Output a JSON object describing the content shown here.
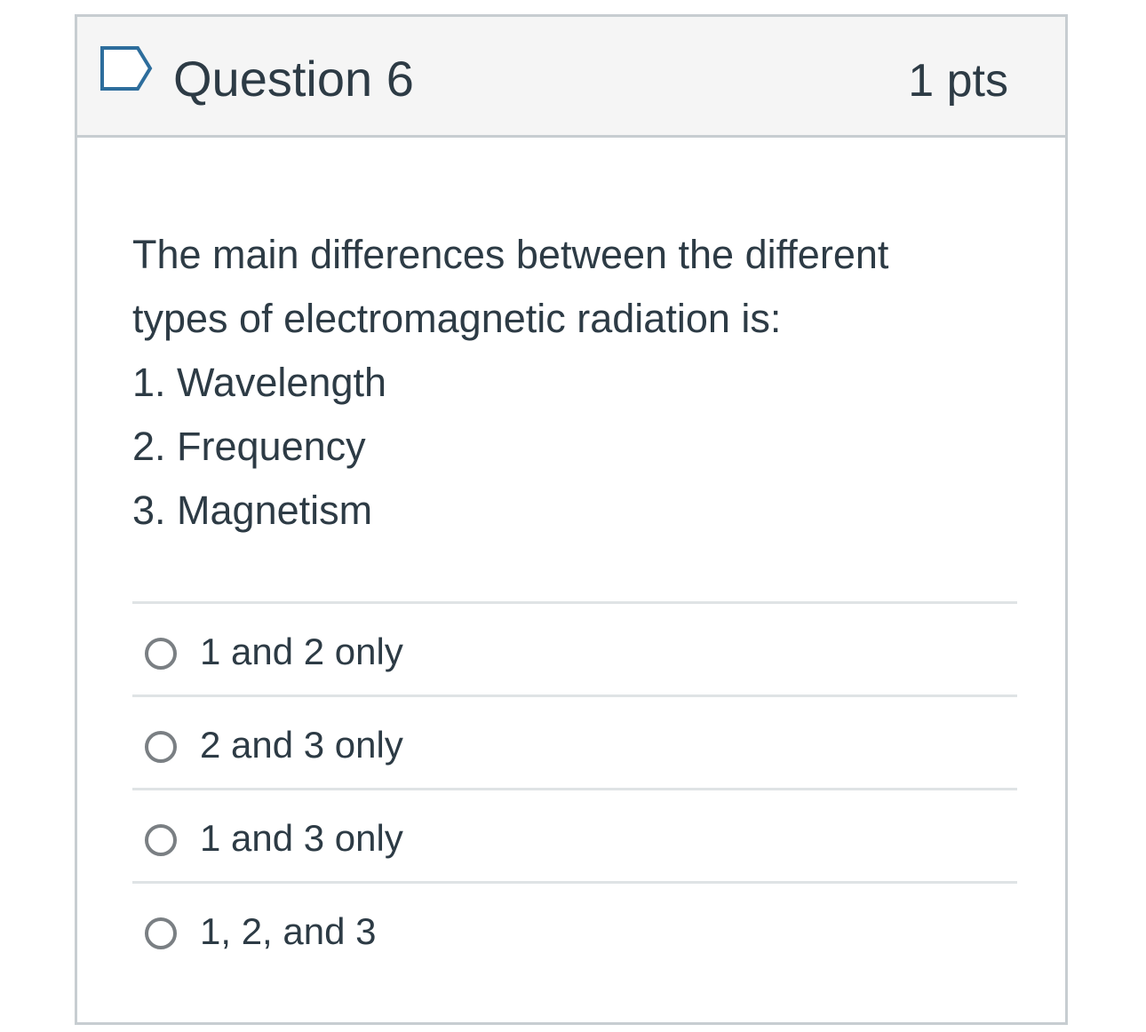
{
  "question": {
    "flag_icon": "bookmark-flag-icon",
    "title": "Question 6",
    "points": "1 pts",
    "prompt_lines": [
      "The main differences between the different",
      "types of electromagnetic radiation is:",
      "1. Wavelength",
      "2. Frequency",
      "3. Magnetism"
    ],
    "answers": [
      {
        "label": "1 and 2 only"
      },
      {
        "label": "2 and 3 only"
      },
      {
        "label": "1 and 3 only"
      },
      {
        "label": "1, 2, and 3"
      }
    ]
  },
  "colors": {
    "text": "#2d3b45",
    "header_bg": "#f5f5f5",
    "border": "#c7cdd1",
    "divider": "#dfe3e5",
    "flag_stroke": "#2d6d9c",
    "radio_border": "#7a7f83"
  }
}
